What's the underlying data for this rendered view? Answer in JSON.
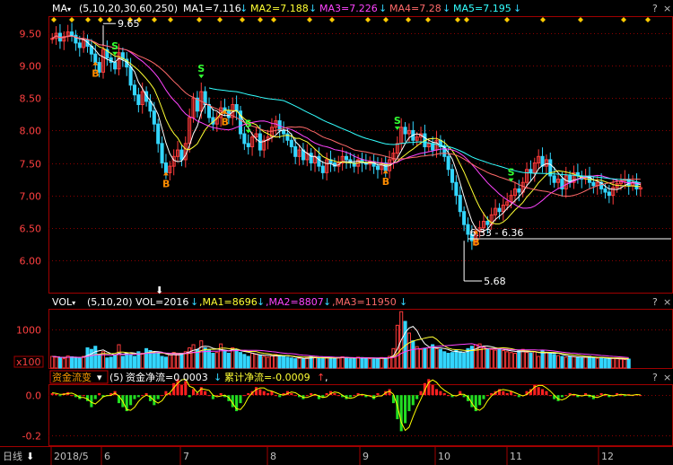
{
  "colors": {
    "up": "#ff3b3b",
    "down": "#33d6ff",
    "ma1": "#ffffff",
    "ma2": "#ffff33",
    "ma3": "#ff44ff",
    "ma4": "#ff6a6a",
    "ma5": "#33ffff",
    "grid": "#8b0000",
    "signalB": "#ff8c00",
    "signalS": "#33ff33",
    "flowPos": "#ff2020",
    "flowNeg": "#22dd22",
    "flowLine": "#ffff00"
  },
  "header": {
    "ma_label": "MA",
    "ma_params": "(5,10,20,30,60,250)",
    "ma1": "MA1=7.116",
    "ma2": "MA2=7.188",
    "ma3": "MA3=7.226",
    "ma4": "MA4=7.28",
    "ma5": "MA5=7.195",
    "arrow": "↓"
  },
  "volume": {
    "label": "VOL",
    "params": "(5,10,20)",
    "vol": "VOL=2016",
    "ma1": ",MA1=8696",
    "ma2": ",MA2=8807",
    "ma3": ",MA3=11950",
    "arrow": "↓"
  },
  "flow": {
    "label": "资金流变",
    "params": "(5)",
    "net": "资金净流=0.0003",
    "cum": "累计净流=-0.0009",
    "up_arrow": "↑",
    "comma": ",",
    "arrow": "↓"
  },
  "panel_buttons": {
    "help": "?",
    "close": "×"
  },
  "footer": {
    "period": "日线",
    "period_arrow": "⬇"
  },
  "chart_data": {
    "type": "candlestick",
    "price_axis": {
      "ticks": [
        "9.50",
        "9.00",
        "8.50",
        "8.00",
        "7.50",
        "7.00",
        "6.50",
        "6.00"
      ],
      "ylim": [
        5.5,
        9.75
      ]
    },
    "volume_axis": {
      "ticks": [
        "1000"
      ],
      "unit": "x100"
    },
    "flow_axis": {
      "ticks": [
        "0.0",
        "-0.2"
      ]
    },
    "x_labels": [
      "2018/5",
      "6",
      "7",
      "8",
      "9",
      "10",
      "11",
      "12"
    ],
    "annotations": {
      "high": "9.65",
      "low": "5.68",
      "range": "6.33 - 6.36"
    },
    "signals": [
      "B",
      "S"
    ],
    "closes": [
      9.42,
      9.5,
      9.38,
      9.45,
      9.52,
      9.47,
      9.35,
      9.28,
      9.4,
      9.3,
      9.18,
      9.05,
      8.9,
      9.25,
      9.12,
      9.05,
      8.95,
      9.2,
      9.1,
      8.98,
      8.7,
      8.55,
      8.4,
      8.6,
      8.45,
      8.3,
      8.1,
      7.8,
      7.5,
      7.35,
      7.45,
      7.6,
      7.7,
      7.55,
      7.8,
      8.2,
      8.5,
      8.3,
      8.6,
      8.4,
      8.2,
      8.1,
      8.2,
      8.35,
      8.3,
      8.2,
      8.4,
      8.3,
      7.95,
      7.8,
      7.75,
      7.9,
      7.95,
      7.7,
      7.85,
      7.9,
      8.05,
      8.15,
      8.0,
      7.95,
      7.85,
      7.75,
      7.6,
      7.7,
      7.55,
      7.65,
      7.5,
      7.6,
      7.45,
      7.35,
      7.55,
      7.5,
      7.45,
      7.5,
      7.6,
      7.55,
      7.5,
      7.45,
      7.55,
      7.5,
      7.48,
      7.52,
      7.45,
      7.4,
      7.5,
      7.38,
      7.55,
      7.65,
      7.8,
      8.05,
      7.95,
      8.0,
      7.85,
      7.9,
      7.95,
      7.75,
      7.8,
      7.7,
      7.85,
      7.75,
      7.6,
      7.4,
      7.2,
      7.0,
      6.75,
      6.55,
      6.4,
      6.3,
      6.45,
      6.5,
      6.6,
      6.55,
      6.7,
      6.8,
      6.75,
      6.85,
      6.9,
      7.0,
      7.1,
      7.05,
      7.2,
      7.4,
      7.35,
      7.5,
      7.6,
      7.45,
      7.55,
      7.3,
      7.2,
      7.25,
      7.1,
      7.3,
      7.2,
      7.35,
      7.3,
      7.25,
      7.3,
      7.2,
      7.15,
      7.2,
      7.1,
      7.05,
      7.0,
      7.12,
      7.18,
      7.22,
      7.25,
      7.15,
      7.2,
      7.1,
      7.12
    ],
    "volumes": [
      300,
      280,
      260,
      240,
      310,
      290,
      270,
      250,
      300,
      520,
      480,
      560,
      350,
      420,
      260,
      280,
      340,
      600,
      300,
      380,
      350,
      300,
      420,
      380,
      500,
      450,
      380,
      400,
      300,
      280,
      350,
      400,
      360,
      380,
      420,
      520,
      600,
      480,
      700,
      520,
      460,
      380,
      400,
      620,
      450,
      380,
      520,
      480,
      400,
      350,
      300,
      380,
      360,
      320,
      300,
      280,
      320,
      350,
      330,
      300,
      280,
      260,
      240,
      250,
      230,
      270,
      300,
      280,
      260,
      240,
      260,
      280,
      250,
      270,
      290,
      260,
      240,
      250,
      280,
      270,
      260,
      240,
      230,
      250,
      270,
      260,
      300,
      500,
      1100,
      1450,
      1200,
      900,
      700,
      550,
      480,
      500,
      520,
      600,
      500,
      480,
      420,
      380,
      400,
      450,
      420,
      380,
      500,
      560,
      600,
      620,
      550,
      500,
      480,
      460,
      500,
      450,
      420,
      400,
      380,
      440,
      480,
      400,
      380,
      420,
      300,
      460,
      400,
      380,
      350,
      320,
      300,
      280,
      300,
      290,
      270,
      260,
      280,
      300,
      270,
      250,
      260,
      240,
      230,
      250,
      240,
      230,
      220,
      230
    ],
    "flow": [
      0.01,
      0.005,
      -0.005,
      0.01,
      0.015,
      0.0,
      -0.01,
      -0.02,
      0.0,
      -0.03,
      -0.06,
      -0.02,
      0.01,
      -0.01,
      -0.005,
      0.01,
      0.02,
      -0.04,
      -0.06,
      -0.08,
      -0.05,
      -0.02,
      -0.01,
      0.0,
      0.01,
      -0.03,
      -0.05,
      -0.02,
      0.0,
      0.02,
      0.01,
      0.06,
      0.08,
      0.05,
      0.07,
      -0.01,
      0.03,
      0.01,
      0.04,
      0.02,
      0.0,
      -0.02,
      0.0,
      0.01,
      -0.01,
      -0.03,
      -0.06,
      -0.08,
      -0.04,
      0.0,
      0.01,
      0.02,
      0.04,
      0.03,
      0.02,
      0.01,
      0.02,
      0.0,
      -0.01,
      0.01,
      0.02,
      0.01,
      0.0,
      -0.01,
      -0.02,
      0.0,
      0.01,
      0.0,
      -0.02,
      -0.01,
      0.01,
      0.02,
      0.01,
      0.0,
      -0.01,
      -0.02,
      -0.01,
      0.0,
      0.01,
      0.0,
      -0.01,
      0.0,
      -0.02,
      0.01,
      0.0,
      0.02,
      0.03,
      -0.04,
      -0.12,
      -0.18,
      -0.14,
      -0.08,
      -0.05,
      -0.02,
      0.02,
      0.06,
      0.08,
      0.05,
      0.03,
      0.02,
      0.01,
      0.0,
      -0.01,
      0.0,
      0.02,
      -0.01,
      -0.03,
      -0.06,
      -0.08,
      -0.05,
      -0.02,
      0.0,
      0.01,
      0.02,
      0.03,
      0.02,
      0.01,
      0.02,
      0.0,
      -0.01,
      0.0,
      0.02,
      0.03,
      0.05,
      0.04,
      0.03,
      0.02,
      0.0,
      -0.02,
      -0.03,
      -0.01,
      0.0,
      0.01,
      0.0,
      -0.01,
      0.0,
      0.01,
      -0.01,
      -0.02,
      0.0,
      0.01,
      0.0,
      -0.01,
      0.0,
      0.01,
      0.0,
      -0.005,
      0.005,
      0.0,
      0.003,
      0.0
    ]
  }
}
